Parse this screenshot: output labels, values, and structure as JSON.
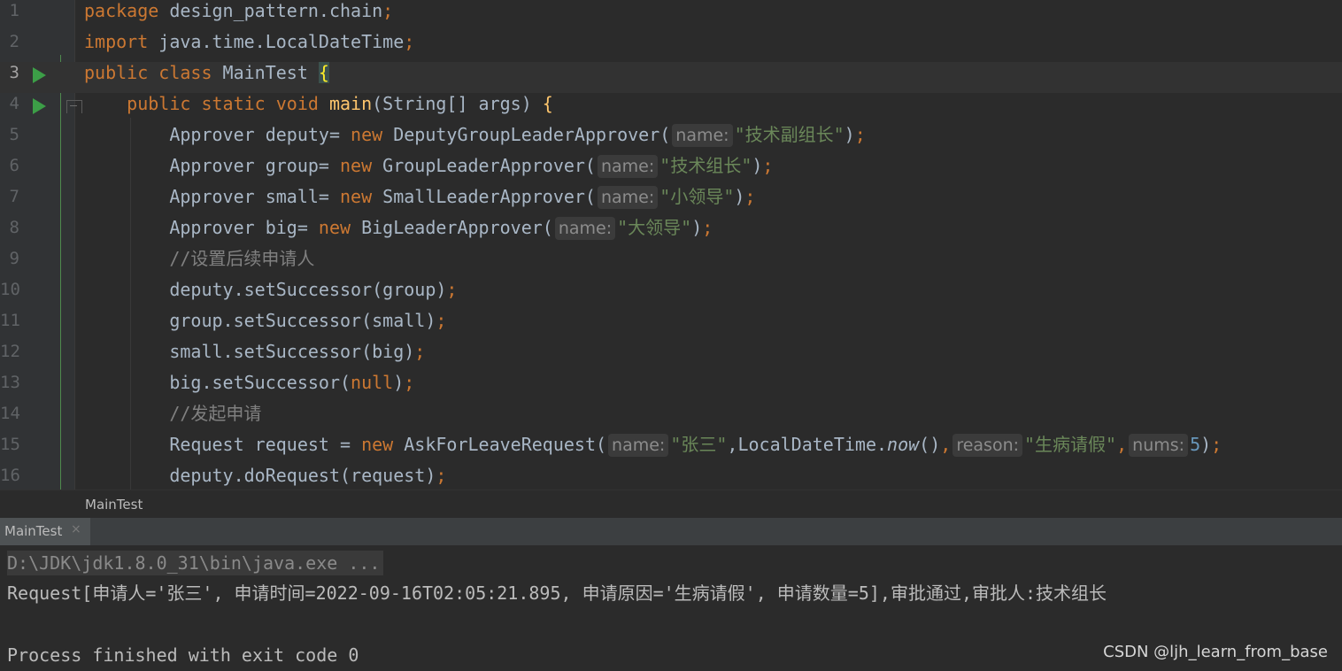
{
  "editor": {
    "lines": [
      {
        "num": "1",
        "tokens": [
          {
            "t": "package ",
            "c": "kw"
          },
          {
            "t": "design_pattern.chain",
            "c": ""
          },
          {
            "t": ";",
            "c": "kw"
          }
        ]
      },
      {
        "num": "2",
        "tokens": [
          {
            "t": "import ",
            "c": "kw"
          },
          {
            "t": "java.time.LocalDateTime",
            "c": ""
          },
          {
            "t": ";",
            "c": "kw"
          }
        ]
      },
      {
        "num": "3",
        "tokens": [
          {
            "t": "public class ",
            "c": "kw"
          },
          {
            "t": "MainTest ",
            "c": ""
          },
          {
            "t": "{",
            "c": "brace-hl"
          }
        ]
      },
      {
        "num": "4",
        "tokens": [
          {
            "t": "    public static void ",
            "c": "kw"
          },
          {
            "t": "main",
            "c": "fn"
          },
          {
            "t": "(String[] args) ",
            "c": ""
          },
          {
            "t": "{",
            "c": "fn"
          }
        ]
      },
      {
        "num": "5",
        "tokens": [
          {
            "t": "        Approver deputy= ",
            "c": ""
          },
          {
            "t": "new ",
            "c": "kw"
          },
          {
            "t": "DeputyGroupLeaderApprover(",
            "c": ""
          },
          {
            "t": "name:",
            "c": "hint"
          },
          {
            "t": "\"技术副组长\"",
            "c": "str"
          },
          {
            "t": ")",
            "c": ""
          },
          {
            "t": ";",
            "c": "kw"
          }
        ]
      },
      {
        "num": "6",
        "tokens": [
          {
            "t": "        Approver group= ",
            "c": ""
          },
          {
            "t": "new ",
            "c": "kw"
          },
          {
            "t": "GroupLeaderApprover(",
            "c": ""
          },
          {
            "t": "name:",
            "c": "hint"
          },
          {
            "t": "\"技术组长\"",
            "c": "str"
          },
          {
            "t": ")",
            "c": ""
          },
          {
            "t": ";",
            "c": "kw"
          }
        ]
      },
      {
        "num": "7",
        "tokens": [
          {
            "t": "        Approver small= ",
            "c": ""
          },
          {
            "t": "new ",
            "c": "kw"
          },
          {
            "t": "SmallLeaderApprover(",
            "c": ""
          },
          {
            "t": "name:",
            "c": "hint"
          },
          {
            "t": "\"小领导\"",
            "c": "str"
          },
          {
            "t": ")",
            "c": ""
          },
          {
            "t": ";",
            "c": "kw"
          }
        ]
      },
      {
        "num": "8",
        "tokens": [
          {
            "t": "        Approver big= ",
            "c": ""
          },
          {
            "t": "new ",
            "c": "kw"
          },
          {
            "t": "BigLeaderApprover(",
            "c": ""
          },
          {
            "t": "name:",
            "c": "hint"
          },
          {
            "t": "\"大领导\"",
            "c": "str"
          },
          {
            "t": ")",
            "c": ""
          },
          {
            "t": ";",
            "c": "kw"
          }
        ]
      },
      {
        "num": "9",
        "tokens": [
          {
            "t": "        //设置后续申请人",
            "c": "cmt"
          }
        ]
      },
      {
        "num": "10",
        "tokens": [
          {
            "t": "        deputy.setSuccessor(group)",
            "c": ""
          },
          {
            "t": ";",
            "c": "kw"
          }
        ]
      },
      {
        "num": "11",
        "tokens": [
          {
            "t": "        group.setSuccessor(small)",
            "c": ""
          },
          {
            "t": ";",
            "c": "kw"
          }
        ]
      },
      {
        "num": "12",
        "tokens": [
          {
            "t": "        small.setSuccessor(big)",
            "c": ""
          },
          {
            "t": ";",
            "c": "kw"
          }
        ]
      },
      {
        "num": "13",
        "tokens": [
          {
            "t": "        big.setSuccessor(",
            "c": ""
          },
          {
            "t": "null",
            "c": "kw"
          },
          {
            "t": ")",
            "c": ""
          },
          {
            "t": ";",
            "c": "kw"
          }
        ]
      },
      {
        "num": "14",
        "tokens": [
          {
            "t": "        //发起申请",
            "c": "cmt"
          }
        ]
      },
      {
        "num": "15",
        "tokens": [
          {
            "t": "        Request request = ",
            "c": ""
          },
          {
            "t": "new ",
            "c": "kw"
          },
          {
            "t": "AskForLeaveRequest(",
            "c": ""
          },
          {
            "t": "name:",
            "c": "hint"
          },
          {
            "t": "\"张三\"",
            "c": "str"
          },
          {
            "t": ",LocalDateTime.",
            "c": ""
          },
          {
            "t": "now",
            "c": "it"
          },
          {
            "t": "()",
            "c": ""
          },
          {
            "t": ",",
            "c": "kw"
          },
          {
            "t": "reason:",
            "c": "hint"
          },
          {
            "t": "\"生病请假\"",
            "c": "str"
          },
          {
            "t": ",",
            "c": "kw"
          },
          {
            "t": "nums:",
            "c": "hint"
          },
          {
            "t": "5",
            "c": "num"
          },
          {
            "t": ")",
            "c": ""
          },
          {
            "t": ";",
            "c": "kw"
          }
        ]
      },
      {
        "num": "16",
        "tokens": [
          {
            "t": "        deputy.doRequest(request)",
            "c": ""
          },
          {
            "t": ";",
            "c": "kw"
          }
        ]
      }
    ]
  },
  "breadcrumb": {
    "label": "MainTest"
  },
  "run_panel": {
    "tab_label": "MainTest",
    "tab_close": "×",
    "console": {
      "command": "D:\\JDK\\jdk1.8.0_31\\bin\\java.exe ...",
      "output": "Request[申请人='张三', 申请时间=2022-09-16T02:05:21.895, 申请原因='生病请假', 申请数量=5],审批通过,审批人:技术组长",
      "exit": "Process finished with exit code 0"
    }
  },
  "watermark": "CSDN @ljh_learn_from_base",
  "colors": {
    "background": "#2b2b2b",
    "keyword": "#cc7832",
    "string": "#6a8759",
    "comment": "#808080",
    "method": "#ffc66d",
    "number": "#6897bb",
    "run_icon": "#3c9e47"
  },
  "icons": [
    "run-gutter-icon",
    "fold-icon",
    "close-icon"
  ]
}
